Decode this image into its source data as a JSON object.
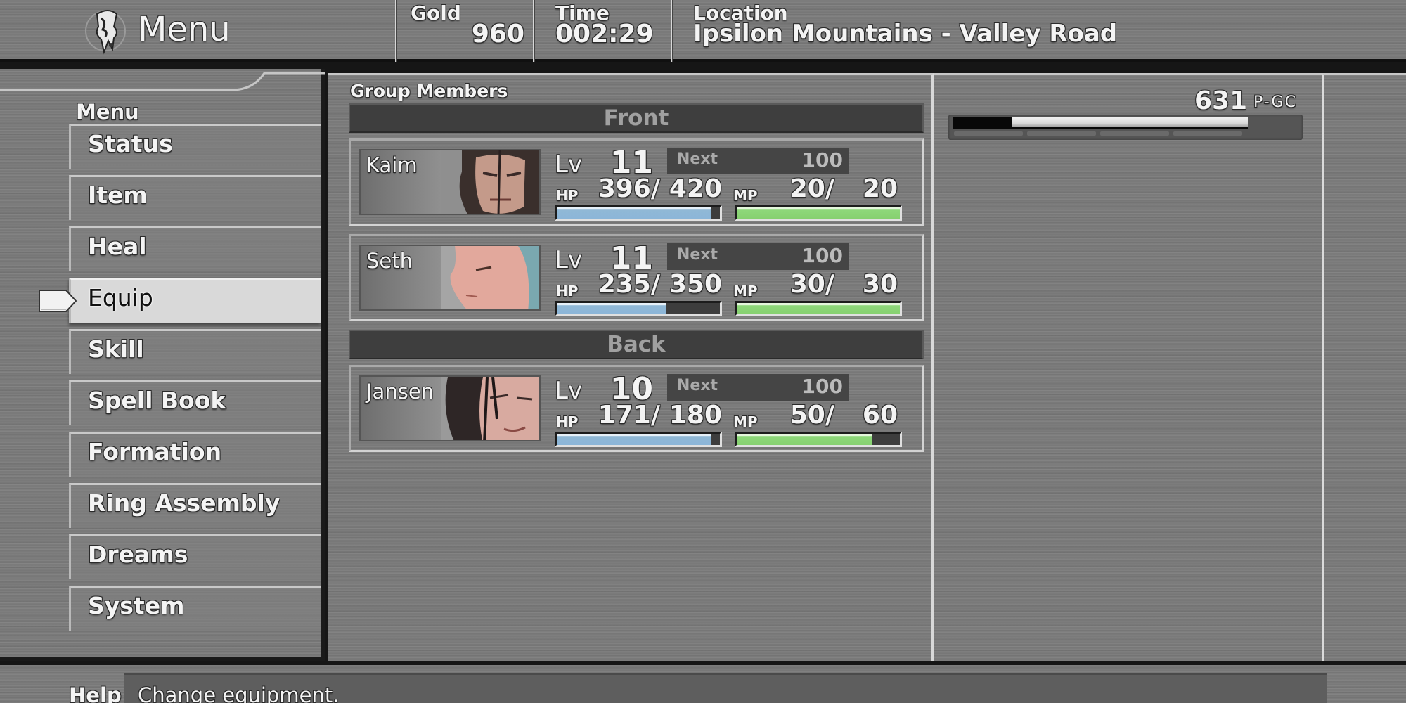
{
  "header": {
    "title": "Menu",
    "logo_icon": "ornate-mask-emblem-icon",
    "gold_label": "Gold",
    "gold_value": "960",
    "time_label": "Time",
    "time_value": "002:29",
    "location_label": "Location",
    "location_value": "Ipsilon Mountains - Valley Road"
  },
  "sidebar": {
    "heading": "Menu",
    "cursor_icon": "pointer-hand-arrow-icon",
    "selected_index": 3,
    "items": [
      {
        "label": "Status"
      },
      {
        "label": "Item"
      },
      {
        "label": "Heal"
      },
      {
        "label": "Equip"
      },
      {
        "label": "Skill"
      },
      {
        "label": "Spell Book"
      },
      {
        "label": "Formation"
      },
      {
        "label": "Ring Assembly"
      },
      {
        "label": "Dreams"
      },
      {
        "label": "System"
      }
    ]
  },
  "party": {
    "title": "Group Members",
    "front_label": "Front",
    "back_label": "Back",
    "labels": {
      "lv": "Lv",
      "next": "Next",
      "hp": "HP",
      "mp": "MP"
    },
    "members": [
      {
        "name": "Kaim",
        "row": "front",
        "lv": "11",
        "next": "100",
        "hp_cur": "396/",
        "hp_max": "420",
        "mp_cur": "20/",
        "mp_max": "20",
        "hp_fraction": 0.943,
        "mp_fraction": 1.0
      },
      {
        "name": "Seth",
        "row": "front",
        "lv": "11",
        "next": "100",
        "hp_cur": "235/",
        "hp_max": "350",
        "mp_cur": "30/",
        "mp_max": "30",
        "hp_fraction": 0.671,
        "mp_fraction": 1.0
      },
      {
        "name": "Jansen",
        "row": "back",
        "lv": "10",
        "next": "100",
        "hp_cur": "171/",
        "hp_max": "180",
        "mp_cur": "50/",
        "mp_max": "60",
        "hp_fraction": 0.95,
        "mp_fraction": 0.833
      }
    ]
  },
  "pgc": {
    "value": "631",
    "unit": "P-GC",
    "fraction": 0.8
  },
  "help": {
    "label": "Help",
    "text": "Change equipment."
  },
  "colors": {
    "hp_bar": "#8cb6d8",
    "mp_bar": "#86d070",
    "panel": "#7a7a7a",
    "selected_item": "#d9d9d9"
  }
}
